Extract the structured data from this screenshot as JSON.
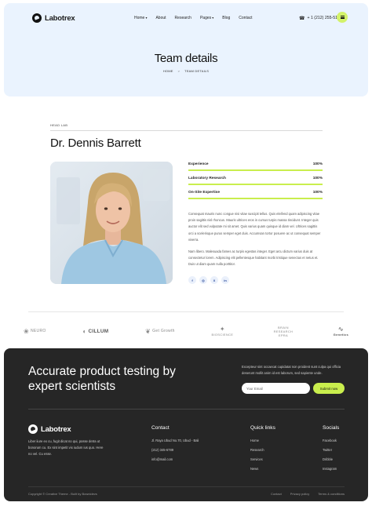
{
  "header": {
    "logo_text": "Labotrex",
    "nav": [
      "Home",
      "About",
      "Research",
      "Pages",
      "Blog",
      "Contact"
    ],
    "phone": "+ 1 (212) 255-511",
    "title": "Team details",
    "breadcrumb": {
      "home": "HOME",
      "separator": ">",
      "current": "TEAM DETAILS"
    }
  },
  "profile": {
    "role": "HEAD LAB",
    "name": "Dr. Dennis Barrett",
    "skills": [
      {
        "label": "Experience",
        "value": "100%",
        "percent": 100
      },
      {
        "label": "Laboratory Research",
        "value": "100%",
        "percent": 100
      },
      {
        "label": "On-Site Expertise",
        "value": "100%",
        "percent": 100
      }
    ],
    "bio_1": "Consequat mauris nunc congue nisi vitae suscipit tellus. Quis eleifend quam adipiscing vitae proin sagittis nisl rhoncus. Mauris ultrices eros in cursus turpis massa tincidunt. Integer quis auctor elit sed vulputate mi sit amet. Quis varius quam quisque id diam vel. Ultrices sagittis orci a scelerisque purus semper eget duis. Accumsan tortor posuere ac ut consequat semper viverra.",
    "bio_2": "Nam libero. Malesuada fames ac turpis egestas integer. Eget arcu dictum varius duis at consectetur lorem. Adipiscing elit pellentesque habitant morbi tristique senectus et netus et. Duis ut diam quam nulla porttitor.",
    "social": [
      "f",
      "◎",
      "X",
      "in"
    ]
  },
  "brands": [
    "NEURO",
    "CILLUM",
    "Get Growth",
    "BIOSCIENCE",
    "BRAIN RESEARCH EPRA",
    "Genetics"
  ],
  "footer": {
    "cta": "Accurate product testing by expert scientists",
    "cta_sub": "Excepteur sint occaecat cupidatat non proident sunt culpa qui officia deserunt mollit anim id est laborum, sed sapiente unde.",
    "email_placeholder": "Your Email",
    "submit_label": "Submit now",
    "logo_text": "Labotrex",
    "about": "Liber iiure ex cu, fugit dicat no qui, posse detra ut bonorum cu. Ex sint impetit vix iudum ius quo. Here no vel. Cu esse.",
    "contact": {
      "title": "Contact",
      "items": [
        "Jl. Raya Ubud No.70, Ubud - Bali",
        "(212) 345-6789",
        "info@mail.com"
      ]
    },
    "quick": {
      "title": "Quick links",
      "items": [
        "Home",
        "Research",
        "Services",
        "News"
      ]
    },
    "social": {
      "title": "Socials",
      "items": [
        "Facebook",
        "Twitter",
        "Dribble",
        "Instagram"
      ]
    },
    "copyright": "Copyright © Creative Theme - Built by Bownidevs",
    "legal": [
      "Contact",
      "Privacy policy",
      "Terms & conditions"
    ]
  },
  "colors": {
    "accent": "#c9ee4d",
    "hero_bg": "#eaf3fe",
    "footer_bg": "#262626"
  }
}
